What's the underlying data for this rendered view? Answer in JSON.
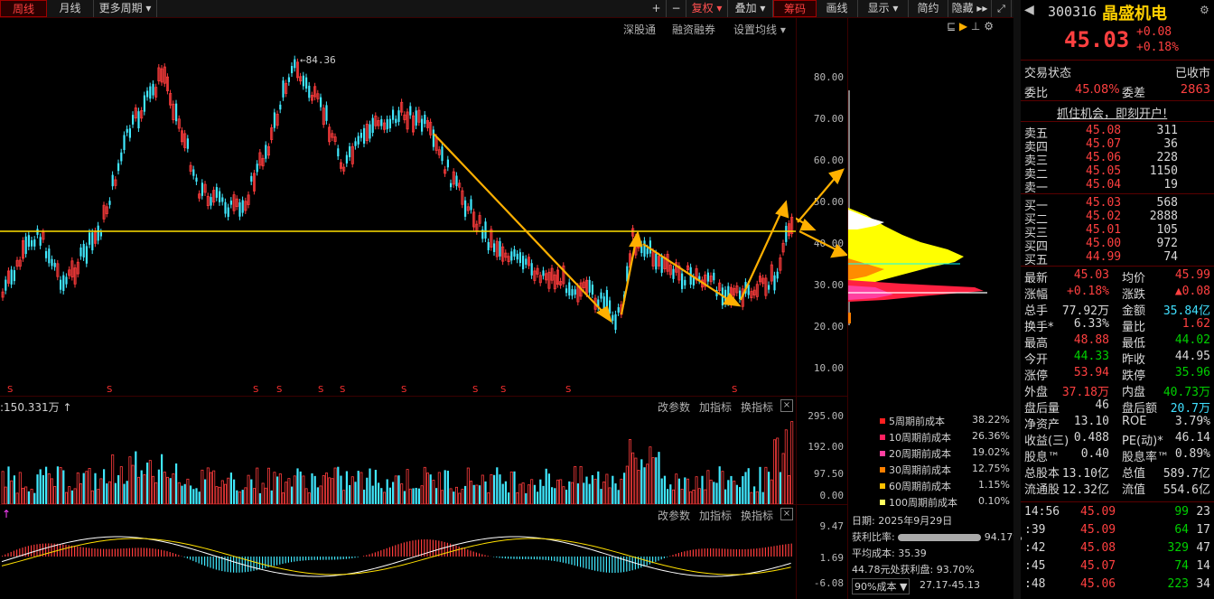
{
  "toolbar": {
    "tabs": [
      "周线",
      "月线",
      "更多周期 ▾"
    ],
    "right": [
      "+",
      "−",
      "复权 ▾",
      "叠加 ▾",
      "筹码",
      "画线",
      "显示 ▾",
      "简约",
      "隐藏 ▸▸"
    ]
  },
  "chart_tabs": {
    "items": [
      "深股通",
      "融资融券",
      "设置均线 ▾"
    ]
  },
  "price_axis": [
    "80.00",
    "70.00",
    "60.00",
    "50.00",
    "40.00",
    "30.00",
    "20.00",
    "10.00"
  ],
  "high_marker": "84.36",
  "volume": {
    "title": ":150.331万 ↑",
    "axis": [
      "295.00",
      "192.00",
      "97.50",
      "0.00"
    ],
    "buttons": [
      "改参数",
      "加指标",
      "换指标"
    ]
  },
  "indicator": {
    "axis": [
      "9.47",
      "1.69",
      "-6.08"
    ],
    "buttons": [
      "改参数",
      "加指标",
      "换指标"
    ]
  },
  "chip": {
    "legend": [
      {
        "label": "5周期前成本",
        "value": "38.22%",
        "color": "#ff2020"
      },
      {
        "label": "10周期前成本",
        "value": "26.36%",
        "color": "#ff2060"
      },
      {
        "label": "20周期前成本",
        "value": "19.02%",
        "color": "#ff40a0"
      },
      {
        "label": "30周期前成本",
        "value": "12.75%",
        "color": "#ff8000"
      },
      {
        "label": "60周期前成本",
        "value": "1.15%",
        "color": "#ffc000"
      },
      {
        "label": "100周期前成本",
        "value": "0.10%",
        "color": "#ffff60"
      }
    ],
    "date": "日期: 2025年9月29日",
    "profit_label": "获利比率:",
    "profit_value": "94.17%",
    "avg_cost": "平均成本: 35.39",
    "profit_line": "44.78元处获利盘: 93.70%",
    "cost_select": "90%成本 ▼",
    "cost_range": "27.17-45.13"
  },
  "stock": {
    "code": "300316",
    "name": "晶盛机电",
    "price": "45.03",
    "change": "+0.08",
    "pct": "+0.18%"
  },
  "status": {
    "label": "交易状态",
    "value": "已收市"
  },
  "ratio": {
    "l1": "委比",
    "v1": "45.08%",
    "l2": "委差",
    "v2": "2863"
  },
  "ad": "抓住机会，即刻开户!",
  "asks": [
    [
      "卖五",
      "45.08",
      "311"
    ],
    [
      "卖四",
      "45.07",
      "36"
    ],
    [
      "卖三",
      "45.06",
      "228"
    ],
    [
      "卖二",
      "45.05",
      "1150"
    ],
    [
      "卖一",
      "45.04",
      "19"
    ]
  ],
  "bids": [
    [
      "买一",
      "45.03",
      "568"
    ],
    [
      "买二",
      "45.02",
      "2888"
    ],
    [
      "买三",
      "45.01",
      "105"
    ],
    [
      "买四",
      "45.00",
      "972"
    ],
    [
      "买五",
      "44.99",
      "74"
    ]
  ],
  "stats": [
    [
      "最新",
      "45.03",
      "均价",
      "45.99"
    ],
    [
      "涨幅",
      "+0.18%",
      "涨跌",
      "▲0.08"
    ],
    [
      "总手",
      "77.92万",
      "金额",
      "35.84亿"
    ],
    [
      "换手*",
      "6.33%",
      "量比",
      "1.62"
    ],
    [
      "最高",
      "48.88",
      "最低",
      "44.02"
    ],
    [
      "今开",
      "44.33",
      "昨收",
      "44.95"
    ],
    [
      "涨停",
      "53.94",
      "跌停",
      "35.96"
    ],
    [
      "外盘",
      "37.18万",
      "内盘",
      "40.73万"
    ],
    [
      "盘后量",
      "46",
      "盘后额",
      "20.7万"
    ],
    [
      "净资产",
      "13.10",
      "ROE",
      "3.79%"
    ],
    [
      "收益(三)",
      "0.488",
      "PE(动)*",
      "46.14"
    ],
    [
      "股息™",
      "0.40",
      "股息率™",
      "0.89%"
    ],
    [
      "总股本",
      "13.10亿",
      "总值",
      "589.7亿"
    ],
    [
      "流通股",
      "12.32亿",
      "流值",
      "554.6亿"
    ]
  ],
  "ticks": [
    [
      "14:56",
      "45.09",
      "99",
      "23"
    ],
    [
      ":39",
      "45.09",
      "64",
      "17"
    ],
    [
      ":42",
      "45.08",
      "329",
      "47"
    ],
    [
      ":45",
      "45.07",
      "74",
      "14"
    ],
    [
      ":48",
      "45.06",
      "223",
      "34"
    ]
  ]
}
